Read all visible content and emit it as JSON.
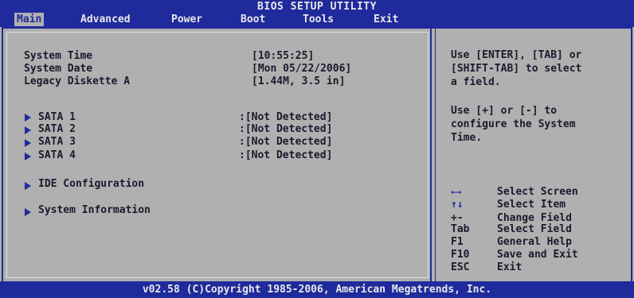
{
  "window": {
    "title": "BIOS SETUP UTILITY"
  },
  "menu": {
    "items": [
      "Main",
      "Advanced",
      "Power",
      "Boot",
      "Tools",
      "Exit"
    ],
    "active": "Main"
  },
  "main": {
    "system_time": {
      "label": "System Time",
      "value": "[10:55:25]"
    },
    "system_date": {
      "label": "System Date",
      "value": "[Mon 05/22/2006]"
    },
    "legacy_diskette": {
      "label": "Legacy Diskette A",
      "value": "[1.44M, 3.5 in]"
    },
    "sata": [
      {
        "label": "SATA 1",
        "value": ":[Not Detected]"
      },
      {
        "label": "SATA 2",
        "value": ":[Not Detected]"
      },
      {
        "label": "SATA 3",
        "value": ":[Not Detected]"
      },
      {
        "label": "SATA 4",
        "value": ":[Not Detected]"
      }
    ],
    "submenus": [
      "IDE Configuration",
      "System Information"
    ]
  },
  "help": {
    "text1": "Use [ENTER], [TAB] or\n[SHIFT-TAB] to select\na field.",
    "text2": "Use [+] or [-] to\nconfigure the System\nTime."
  },
  "keys": [
    {
      "key": "←→",
      "icon": "left-right-arrows-icon",
      "desc": "Select Screen"
    },
    {
      "key": "↑↓",
      "icon": "up-down-arrows-icon",
      "desc": "Select Item"
    },
    {
      "key": "+-",
      "icon": "",
      "desc": "Change Field"
    },
    {
      "key": "Tab",
      "icon": "",
      "desc": "Select Field"
    },
    {
      "key": "F1",
      "icon": "",
      "desc": "General Help"
    },
    {
      "key": "F10",
      "icon": "",
      "desc": "Save and Exit"
    },
    {
      "key": "ESC",
      "icon": "",
      "desc": "Exit"
    }
  ],
  "footer": {
    "text": "v02.58 (C)Copyright 1985-2006, American Megatrends, Inc."
  },
  "colors": {
    "bar": "#1f2a9c",
    "panel": "#b0b0b0",
    "text": "#1a1a2e"
  }
}
